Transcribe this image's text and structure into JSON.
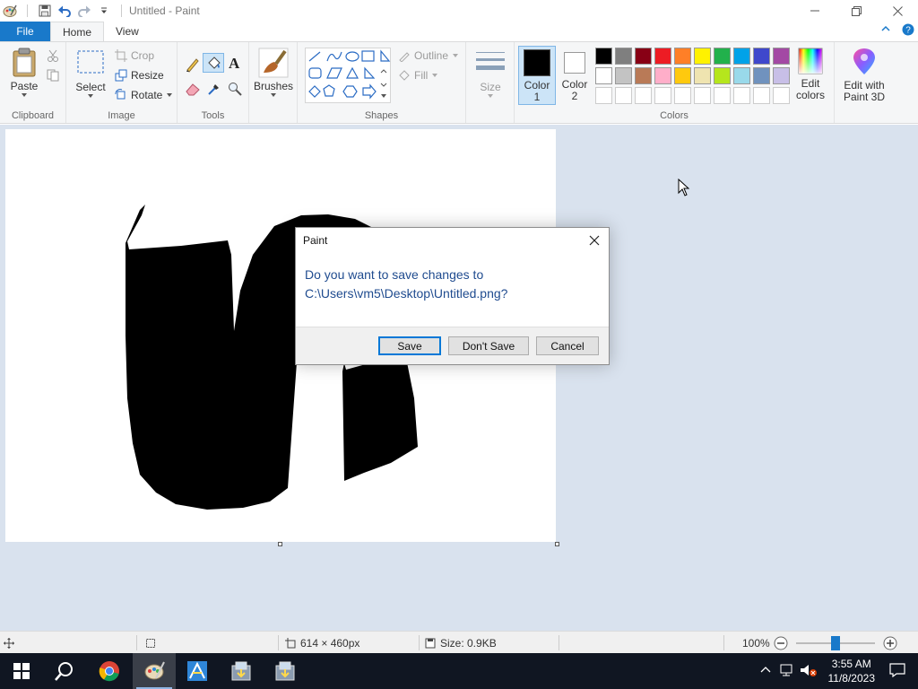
{
  "window": {
    "title": "Untitled - Paint",
    "controls": {
      "minimize": "—",
      "maximize": "☐",
      "close": "✕"
    }
  },
  "ribbon_tabs": {
    "file": "File",
    "home": "Home",
    "view": "View"
  },
  "ribbon": {
    "clipboard": {
      "label": "Clipboard",
      "paste": "Paste"
    },
    "image": {
      "label": "Image",
      "select": "Select",
      "crop": "Crop",
      "resize": "Resize",
      "rotate": "Rotate"
    },
    "tools": {
      "label": "Tools"
    },
    "brushes": {
      "label": "Brushes"
    },
    "shapes": {
      "label": "Shapes",
      "outline": "Outline",
      "fill": "Fill"
    },
    "size": {
      "label": "Size"
    },
    "colors": {
      "label": "Colors",
      "color1": "Color\n1",
      "color1_a": "Color",
      "color1_b": "1",
      "color2_a": "Color",
      "color2_b": "2",
      "edit_colors_a": "Edit",
      "edit_colors_b": "colors",
      "color1_value": "#000000",
      "color2_value": "#ffffff",
      "palette_row1": [
        "#000000",
        "#7f7f7f",
        "#880015",
        "#ed1c24",
        "#ff7f27",
        "#fff200",
        "#22b14c",
        "#00a2e8",
        "#3f48cc",
        "#a349a4"
      ],
      "palette_row2": [
        "#ffffff",
        "#c3c3c3",
        "#b97a57",
        "#ffaec9",
        "#ffc90e",
        "#efe4b0",
        "#b5e61d",
        "#99d9ea",
        "#7092be",
        "#c8bfe7"
      ]
    },
    "paint3d": {
      "line1": "Edit with",
      "line2": "Paint 3D"
    }
  },
  "dialog": {
    "title": "Paint",
    "message_line1": "Do you want to save changes to",
    "message_line2": "C:\\Users\\vm5\\Desktop\\Untitled.png?",
    "save": "Save",
    "dont_save": "Don't Save",
    "cancel": "Cancel"
  },
  "statusbar": {
    "dimensions": "614 × 460px",
    "size": "Size: 0.9KB",
    "zoom": "100%",
    "zoom_level": 0.5
  },
  "taskbar": {
    "time": "3:55 AM",
    "date": "11/8/2023"
  }
}
